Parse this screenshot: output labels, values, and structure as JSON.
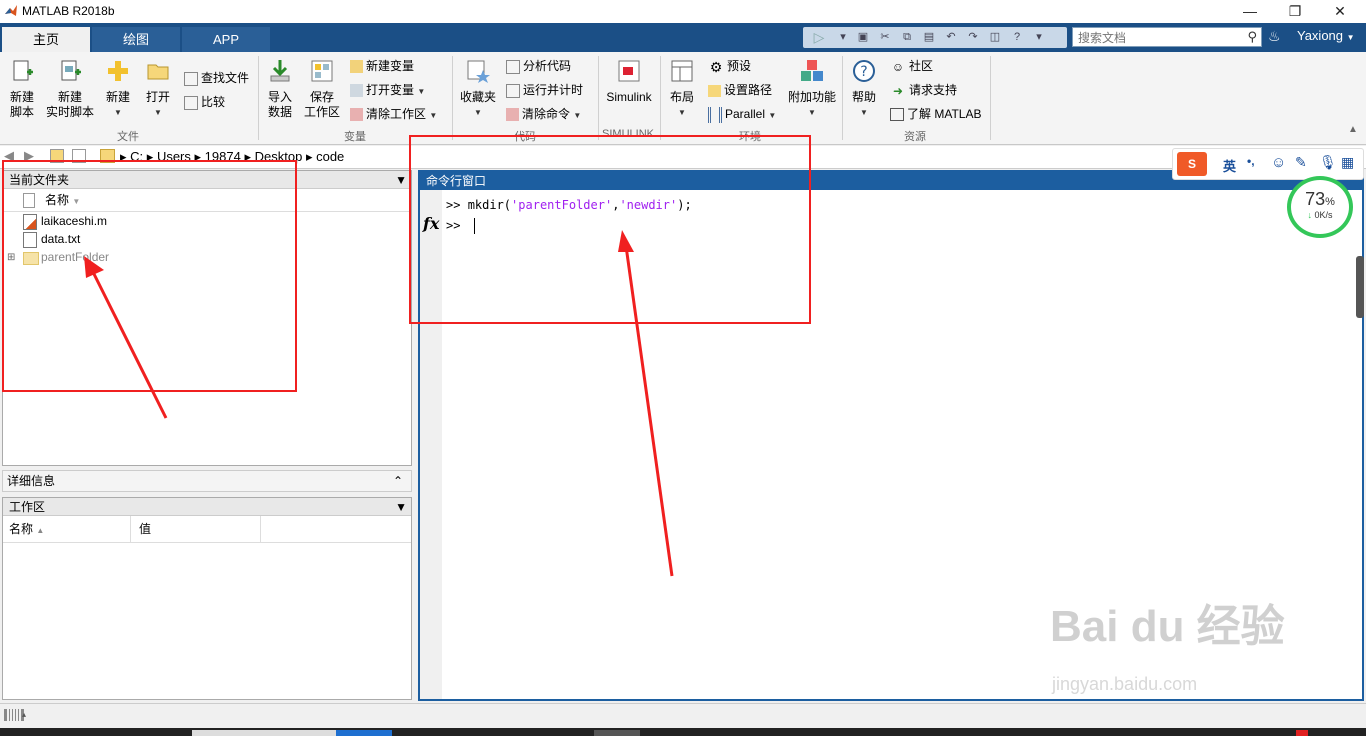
{
  "window": {
    "title": "MATLAB R2018b"
  },
  "tabs": [
    {
      "label": "主页"
    },
    {
      "label": "绘图"
    },
    {
      "label": "APP"
    }
  ],
  "search": {
    "placeholder": "搜索文档"
  },
  "user": {
    "name": "Yaxiong"
  },
  "ribbon": {
    "file": {
      "new_script": "新建\n脚本",
      "new_live_script": "新建\n实时脚本",
      "new": "新建",
      "open": "打开",
      "find_files": "查找文件",
      "compare": "比较",
      "group_label": "文件"
    },
    "variable": {
      "import_data": "导入\n数据",
      "save_workspace": "保存\n工作区",
      "new_variable": "新建变量",
      "open_variable": "打开变量",
      "clear_workspace": "清除工作区",
      "group_label": "变量"
    },
    "code": {
      "favorites": "收藏夹",
      "analyze_code": "分析代码",
      "run_and_time": "运行并计时",
      "clear_commands": "清除命令",
      "group_label": "代码"
    },
    "simulink": {
      "simulink": "Simulink",
      "group_label": "SIMULINK"
    },
    "environment": {
      "layout": "布局",
      "preferences": "预设",
      "set_path": "设置路径",
      "parallel": "Parallel",
      "addons": "附加功能",
      "group_label": "环境"
    },
    "resources": {
      "help": "帮助",
      "community": "社区",
      "request_support": "请求支持",
      "learn_matlab": "了解 MATLAB",
      "group_label": "资源"
    }
  },
  "address": {
    "crumbs": [
      "C:",
      "Users",
      "19874",
      "Desktop",
      "code"
    ]
  },
  "current_folder": {
    "title": "当前文件夹",
    "col_name": "名称",
    "files": [
      {
        "name": "laikaceshi.m",
        "type": "m"
      },
      {
        "name": "data.txt",
        "type": "txt"
      },
      {
        "name": "parentFolder",
        "type": "folder"
      }
    ]
  },
  "details": {
    "title": "详细信息"
  },
  "workspace": {
    "title": "工作区",
    "col_name": "名称",
    "col_value": "值"
  },
  "command_window": {
    "title": "命令行窗口",
    "history": [
      {
        "prompt": ">>",
        "cmd": "mkdir(",
        "arg1": "'parentFolder'",
        "sep": ",",
        "arg2": "'newdir'",
        "end": ");"
      }
    ],
    "current_prompt": ">>",
    "fx": "fx"
  },
  "ime": {
    "lang": "英",
    "punct": "•,"
  },
  "net": {
    "percent": "73",
    "unit": "%",
    "speed": "0K/s"
  },
  "watermark": {
    "brand": "Bai du 经验",
    "url": "jingyan.baidu.com"
  },
  "colors": {
    "accent": "#1c5ea0",
    "tab_strip": "#1b4f86",
    "annotation": "#f02020",
    "string": "#a020f0"
  }
}
